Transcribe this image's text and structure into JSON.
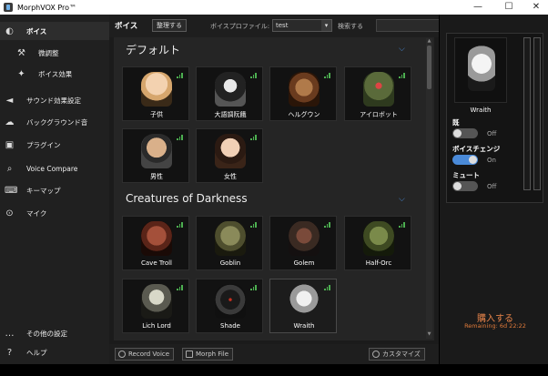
{
  "window": {
    "title": "MorphVOX Pro™",
    "minimize": "—",
    "maximize": "☐",
    "close": "✕"
  },
  "sidebar": {
    "items": [
      {
        "label": "ボイス",
        "icon": "voice-icon",
        "glyph": "◐"
      },
      {
        "label": "微調整",
        "icon": "tools-icon",
        "glyph": "⚒"
      },
      {
        "label": "ボイス効果",
        "icon": "sparkle-icon",
        "glyph": "✦"
      },
      {
        "label": "サウンド効果設定",
        "icon": "speaker-icon",
        "glyph": "◄"
      },
      {
        "label": "バックグラウンド音",
        "icon": "cloud-icon",
        "glyph": "☁"
      },
      {
        "label": "プラグイン",
        "icon": "plugin-icon",
        "glyph": "▣"
      },
      {
        "label": "Voice Compare",
        "icon": "magnifier-icon",
        "glyph": "⌕"
      },
      {
        "label": "キーマップ",
        "icon": "keymap-icon",
        "glyph": "⌨"
      },
      {
        "label": "マイク",
        "icon": "mic-icon",
        "glyph": "⊙"
      },
      {
        "label": "その他の設定",
        "icon": "more-icon",
        "glyph": "…"
      },
      {
        "label": "ヘルプ",
        "icon": "help-icon",
        "glyph": "?"
      }
    ]
  },
  "toolbar": {
    "title": "ボイス",
    "organize_button": "整理する",
    "profile_label": "ボイスプロファイル:",
    "profile_value": "test",
    "search_label": "検索する",
    "dropdown_arrow": "▾"
  },
  "sections": [
    {
      "title": "デフォルト",
      "chevron": "⌵",
      "voices": [
        "子供",
        "大語調阮餓",
        "ヘルグウン",
        "アイロボット",
        "男性",
        "女性"
      ]
    },
    {
      "title": "Creatures of Darkness",
      "chevron": "⌵",
      "voices": [
        "Cave Troll",
        "Goblin",
        "Golem",
        "Half-Orc",
        "Lich Lord",
        "Shade",
        "Wraith"
      ]
    }
  ],
  "bottom": {
    "record_voice": "Record Voice",
    "morph_file": "Morph File",
    "customize": "カスタマイズ"
  },
  "right_panel": {
    "selected_voice": "Wraith",
    "controls": [
      {
        "label": "既",
        "state": "Off",
        "on": false
      },
      {
        "label": "ボイスチェンジ",
        "state": "On",
        "on": true
      },
      {
        "label": "ミュート",
        "state": "Off",
        "on": false
      }
    ],
    "buy": "購入する",
    "remaining": "Remaining: 6d 22:22"
  },
  "colors": {
    "accent": "#4a8ad8",
    "buy": "#e8844a",
    "signal": "#4caf50"
  }
}
